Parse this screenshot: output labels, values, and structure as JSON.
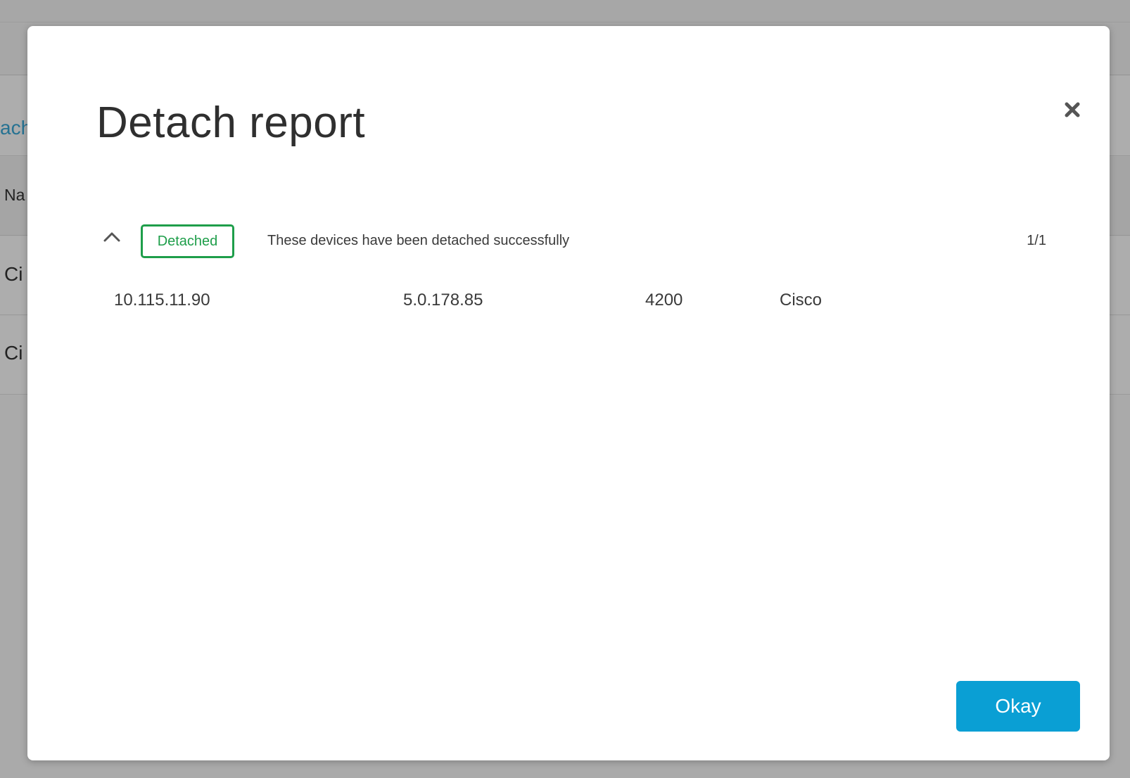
{
  "background": {
    "tab_fragment": "ach",
    "header_fragment": "Na",
    "rows": [
      "Ci",
      "Ci"
    ]
  },
  "modal": {
    "title": "Detach report",
    "close_icon": "close-icon",
    "report": {
      "status": "Detached",
      "status_color": "#1e9e4a",
      "message": "These devices have been detached successfully",
      "count": "1/1",
      "devices": [
        {
          "ip": "10.115.11.90",
          "address": "5.0.178.85",
          "model": "4200",
          "vendor": "Cisco"
        }
      ]
    },
    "ok_label": "Okay",
    "ok_color": "#0a9fd4"
  }
}
